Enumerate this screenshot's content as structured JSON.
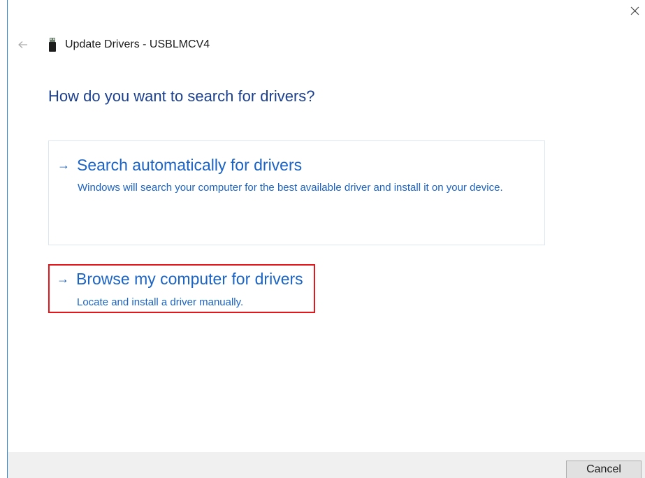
{
  "window": {
    "title": "Update Drivers - USBLMCV4",
    "close_icon": "close-icon",
    "back_icon": "back-arrow-icon",
    "device_icon": "usb-device-icon"
  },
  "page": {
    "heading": "How do you want to search for drivers?"
  },
  "options": [
    {
      "arrow": "→",
      "title": "Search automatically for drivers",
      "description": "Windows will search your computer for the best available driver and install it on your device."
    },
    {
      "arrow": "→",
      "title": "Browse my computer for drivers",
      "description": "Locate and install a driver manually.",
      "highlighted": true,
      "highlight_color": "#e3161b"
    }
  ],
  "footer": {
    "cancel_label": "Cancel"
  },
  "colors": {
    "heading": "#1b3f8f",
    "link": "#1b63c4",
    "accent_border": "#2b88d8",
    "footer_bg": "#f0f0f0"
  }
}
